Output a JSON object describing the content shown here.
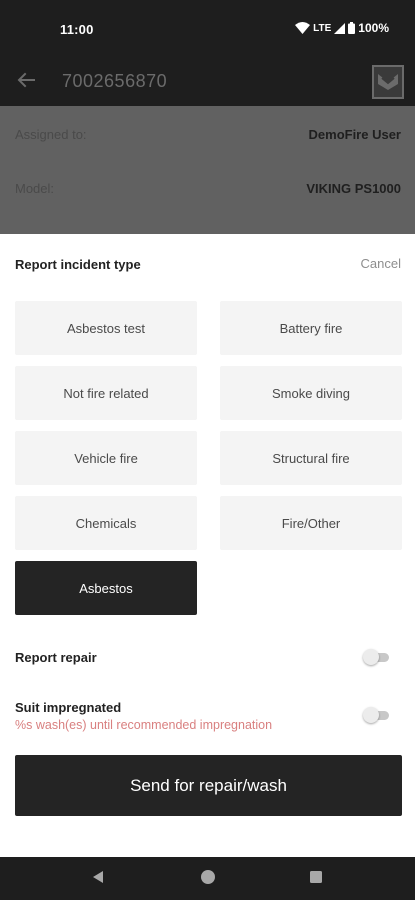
{
  "status_bar": {
    "time": "11:00",
    "network": "LTE",
    "battery": "100%"
  },
  "app_bar": {
    "title": "7002656870",
    "back_icon": "arrow-left-icon",
    "logo_icon": "company-logo"
  },
  "info": {
    "assigned_label": "Assigned to:",
    "assigned_value": "DemoFire User",
    "model_label": "Model:",
    "model_value": "VIKING PS1000"
  },
  "sheet": {
    "title": "Report incident type",
    "cancel_label": "Cancel",
    "incident_types": [
      "Asbestos test",
      "Battery fire",
      "Not fire related",
      "Smoke diving",
      "Vehicle fire",
      "Structural fire",
      "Chemicals",
      "Fire/Other",
      "Asbestos"
    ],
    "selected_type": "Asbestos",
    "report_repair_label": "Report repair",
    "report_repair_on": false,
    "suit_impregnated_label": "Suit impregnated",
    "suit_impregnated_sub": "%s wash(es) until recommended impregnation",
    "suit_impregnated_on": false,
    "send_button_label": "Send for repair/wash"
  },
  "nav_bar": {
    "back_icon": "triangle-back-icon",
    "home_icon": "circle-home-icon",
    "recents_icon": "square-recents-icon"
  },
  "colors": {
    "dark": "#242424",
    "overlay": "#616161",
    "warning_text": "#d98080"
  }
}
